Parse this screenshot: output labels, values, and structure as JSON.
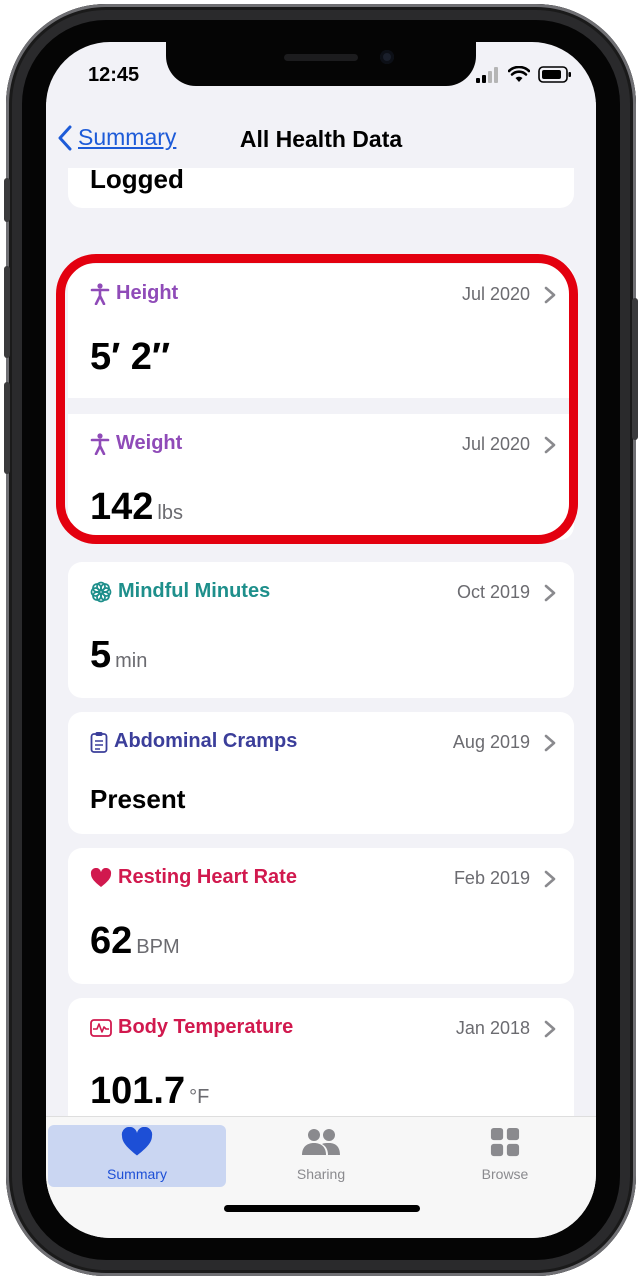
{
  "status_bar": {
    "time": "12:45"
  },
  "header": {
    "back_label": "Summary",
    "title": "All Health Data"
  },
  "partial_card": {
    "value": "Logged"
  },
  "cards": [
    {
      "name": "Height",
      "date": "Jul 2020",
      "value": "5′ 2″",
      "unit": "",
      "icon": "figure-icon",
      "color": "#8f4bb8"
    },
    {
      "name": "Weight",
      "date": "Jul 2020",
      "value": "142",
      "unit": "lbs",
      "icon": "figure-icon",
      "color": "#8f4bb8"
    },
    {
      "name": "Mindful Minutes",
      "date": "Oct 2019",
      "value": "5",
      "unit": "min",
      "icon": "flower-icon",
      "color": "#1e8f8b"
    },
    {
      "name": "Abdominal Cramps",
      "date": "Aug 2019",
      "value": "Present",
      "unit": "",
      "icon": "clipboard-icon",
      "color": "#3b3e9a"
    },
    {
      "name": "Resting Heart Rate",
      "date": "Feb 2019",
      "value": "62",
      "unit": "BPM",
      "icon": "heart-icon",
      "color": "#d1194e"
    },
    {
      "name": "Body Temperature",
      "date": "Jan 2018",
      "value": "101.7",
      "unit": "°F",
      "icon": "thermometer-waveform-icon",
      "color": "#d1194e"
    }
  ],
  "tabs": [
    {
      "label": "Summary",
      "icon": "heart-icon",
      "active": true
    },
    {
      "label": "Sharing",
      "icon": "people-icon",
      "active": false
    },
    {
      "label": "Browse",
      "icon": "grid-icon",
      "active": false
    }
  ],
  "colors": {
    "accent": "#1d5bd8",
    "highlight": "#e3000f",
    "background": "#f2f2f7"
  }
}
